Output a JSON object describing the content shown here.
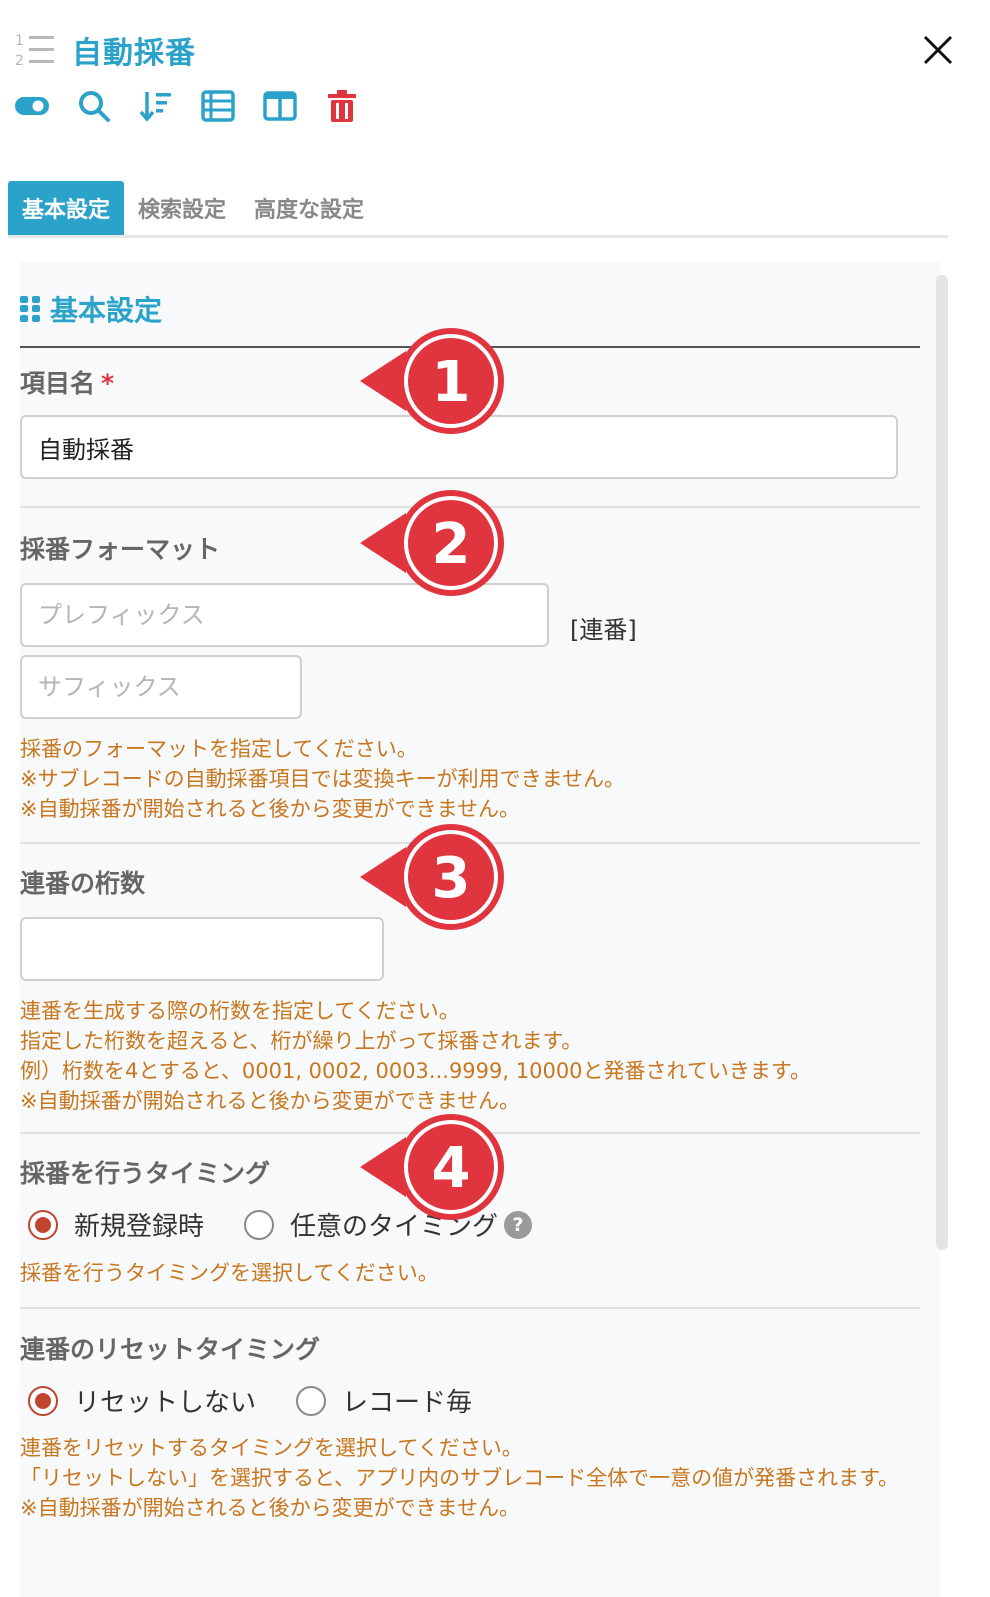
{
  "header": {
    "title": "自動採番",
    "title_icon": "numbered-list-icon",
    "close_icon": "close-icon"
  },
  "toolbar": {
    "icons": [
      "toggle-icon",
      "search-icon",
      "sort-icon",
      "list-view-icon",
      "column-view-icon",
      "trash-icon"
    ]
  },
  "tabs": [
    {
      "label": "基本設定",
      "active": true
    },
    {
      "label": "検索設定",
      "active": false
    },
    {
      "label": "高度な設定",
      "active": false
    }
  ],
  "section": {
    "title": "基本設定"
  },
  "fields": {
    "item_name": {
      "label": "項目名",
      "required_mark": "*",
      "value": "自動採番"
    },
    "format": {
      "label": "採番フォーマット",
      "prefix_placeholder": "プレフィックス",
      "serial_label": "[連番]",
      "suffix_placeholder": "サフィックス",
      "help": "採番のフォーマットを指定してください。\n※サブレコードの自動採番項目では変換キーが利用できません。\n※自動採番が開始されると後から変更ができません。"
    },
    "digits": {
      "label": "連番の桁数",
      "value": "",
      "help": "連番を生成する際の桁数を指定してください。\n指定した桁数を超えると、桁が繰り上がって採番されます。\n例）桁数を4とすると、0001, 0002, 0003...9999, 10000と発番されていきます。\n※自動採番が開始されると後から変更ができません。"
    },
    "timing": {
      "label": "採番を行うタイミング",
      "options": [
        {
          "label": "新規登録時",
          "selected": true
        },
        {
          "label": "任意のタイミング",
          "selected": false
        }
      ],
      "help_icon_text": "?",
      "help": "採番を行うタイミングを選択してください。"
    },
    "reset": {
      "label": "連番のリセットタイミング",
      "options": [
        {
          "label": "リセットしない",
          "selected": true
        },
        {
          "label": "レコード毎",
          "selected": false
        }
      ],
      "help": "連番をリセットするタイミングを選択してください。\n「リセットしない」を選択すると、アプリ内のサブレコード全体で一意の値が発番されます。\n※自動採番が開始されると後から変更ができません。"
    }
  },
  "callouts": [
    "1",
    "2",
    "3",
    "4"
  ],
  "colors": {
    "accent": "#2aa2c9",
    "help_text": "#c8771f",
    "callout": "#e0353f",
    "radio_selected": "#c0452f",
    "delete": "#e0353f"
  }
}
